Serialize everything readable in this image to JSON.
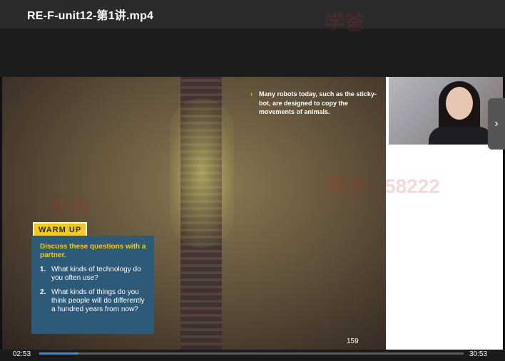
{
  "window": {
    "title": "RE-F-unit12-第1讲.mp4"
  },
  "slide": {
    "caption": "Many robots today, such as the sticky-bot, are designed to copy the movements of animals.",
    "warm_up": {
      "badge": "WARM UP",
      "heading": "Discuss these questions with a partner.",
      "questions": [
        {
          "num": "1.",
          "text": "What kinds of technology do you often use?"
        },
        {
          "num": "2.",
          "text": "What kinds of things do you think people will do differently a hundred years from now?"
        }
      ]
    },
    "page_number": "159"
  },
  "player": {
    "current_time": "02:53",
    "total_time": "30:53",
    "progress_fraction": 0.093
  },
  "watermark": {
    "text1": "学爸",
    "text2": "微信：58222"
  },
  "colors": {
    "accent": "#2f8fe6",
    "warm_badge": "#f3c81e",
    "warm_box": "#2d5a78"
  }
}
